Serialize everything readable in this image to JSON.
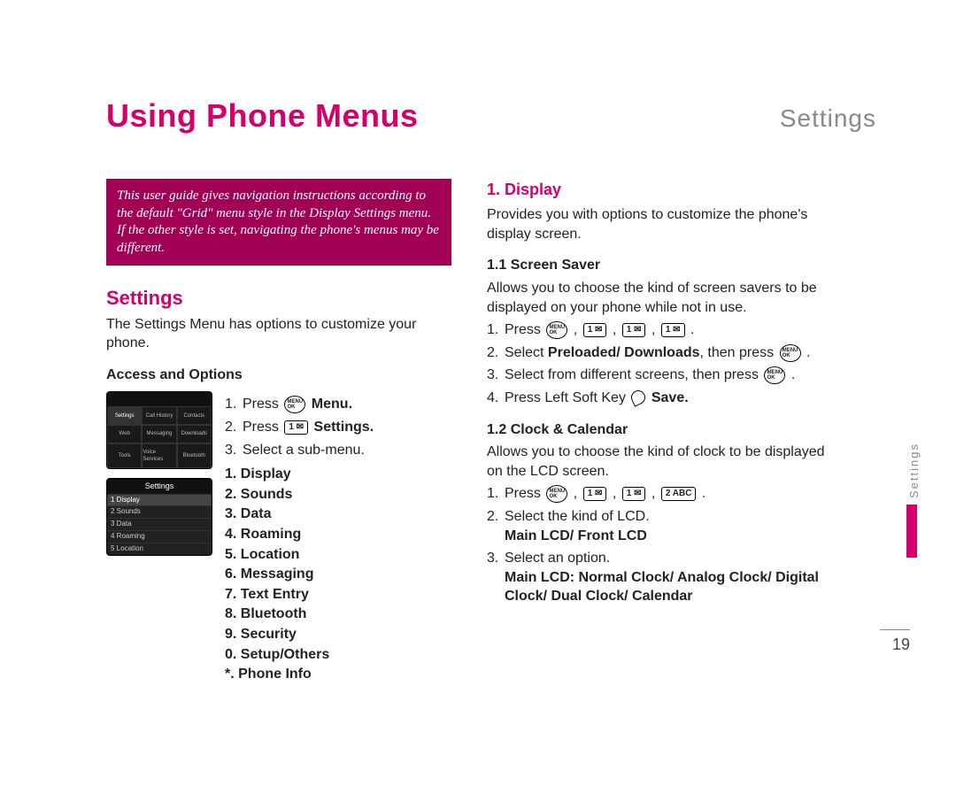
{
  "header": {
    "title": "Using Phone Menus",
    "section": "Settings"
  },
  "note": "This user guide gives navigation instructions according to the default \"Grid\" menu style in the Display Settings menu. If the other style is set, navigating the phone's menus may be different.",
  "left": {
    "title": "Settings",
    "intro": "The Settings Menu has options to customize your phone.",
    "access_title": "Access and Options",
    "step1_pre": "Press ",
    "step1_post": " Menu.",
    "step2_pre": "Press ",
    "step2_key": "1 ✉",
    "step2_post": " Settings.",
    "step3": "Select a sub-menu.",
    "submenu": [
      "1. Display",
      "2. Sounds",
      "3. Data",
      "4. Roaming",
      "5. Location",
      "6. Messaging",
      "7. Text Entry",
      "8. Bluetooth",
      "9. Security",
      "0. Setup/Others",
      "*. Phone Info"
    ],
    "screen1_cells": [
      "Settings",
      "Call History",
      "Contacts",
      "Web",
      "Messaging",
      "Downloads",
      "Tools",
      "Voice Services",
      "Bluetooth"
    ],
    "screen2_title": "Settings",
    "screen2_rows": [
      "1 Display",
      "2 Sounds",
      "3 Data",
      "4 Roaming",
      "5 Location"
    ]
  },
  "right": {
    "h1": "1. Display",
    "h1_body": "Provides you with options to customize the phone's display screen.",
    "s11": "1.1 Screen Saver",
    "s11_body": "Allows you to choose the kind of screen savers to be displayed on your phone while not in use.",
    "s11_step1": "Press ",
    "s11_step2_pre": "Select ",
    "s11_step2_bold": "Preloaded/ Downloads",
    "s11_step2_post": ", then press ",
    "s11_step3_pre": "Select from different screens, then press ",
    "s11_step4_pre": "Press Left Soft Key ",
    "s11_step4_post": " Save.",
    "s12": "1.2 Clock & Calendar",
    "s12_body": "Allows you to choose the kind of clock to be displayed on the LCD screen.",
    "s12_step1": "Press ",
    "s12_step2": "Select the kind of LCD.",
    "s12_step2_bold": "Main LCD/ Front LCD",
    "s12_step3": "Select an option.",
    "s12_step3_bold": "Main LCD: Normal Clock/ Analog Clock/ Digital Clock/ Dual Clock/ Calendar",
    "key_1m": "1 ✉",
    "key_2abc": "2 ABC"
  },
  "page_number": "19",
  "side_label": "Settings"
}
